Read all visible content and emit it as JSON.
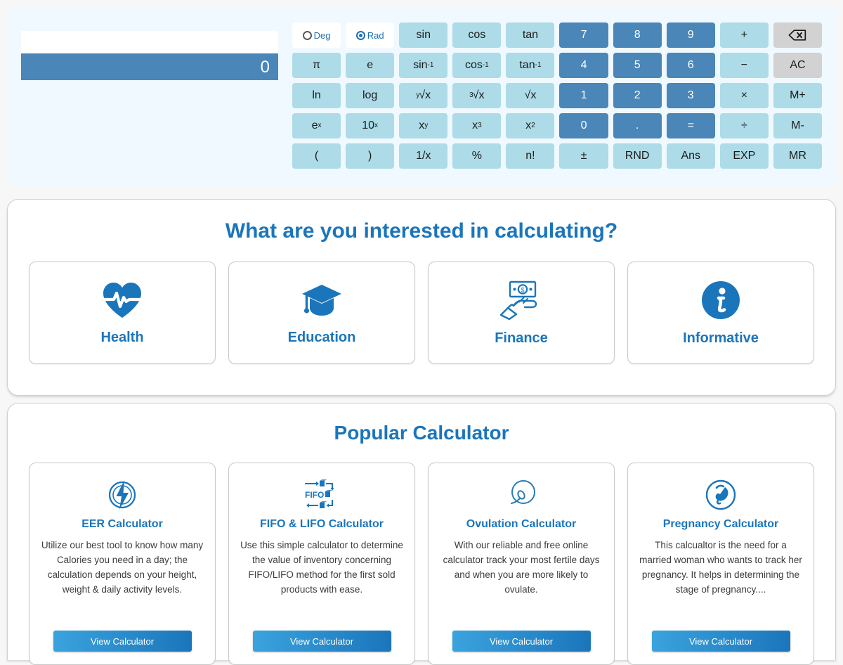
{
  "calculator": {
    "expression": "",
    "result": "0",
    "angle_modes": [
      {
        "label": "Deg",
        "selected": false
      },
      {
        "label": "Rad",
        "selected": true
      }
    ],
    "keys": [
      {
        "label": "sin",
        "type": "func"
      },
      {
        "label": "cos",
        "type": "func"
      },
      {
        "label": "tan",
        "type": "func"
      },
      {
        "label": "7",
        "type": "num"
      },
      {
        "label": "8",
        "type": "num"
      },
      {
        "label": "9",
        "type": "num"
      },
      {
        "label": "+",
        "type": "func"
      },
      {
        "label": "backspace-icon",
        "type": "gray"
      },
      {
        "label": "π",
        "type": "func"
      },
      {
        "label": "e",
        "type": "func"
      },
      {
        "label": "sin-1",
        "type": "func"
      },
      {
        "label": "cos-1",
        "type": "func"
      },
      {
        "label": "tan-1",
        "type": "func"
      },
      {
        "label": "4",
        "type": "num"
      },
      {
        "label": "5",
        "type": "num"
      },
      {
        "label": "6",
        "type": "num"
      },
      {
        "label": "−",
        "type": "func"
      },
      {
        "label": "AC",
        "type": "gray"
      },
      {
        "label": "ln",
        "type": "func"
      },
      {
        "label": "log",
        "type": "func"
      },
      {
        "label": "y√x",
        "type": "func"
      },
      {
        "label": "3√x",
        "type": "func"
      },
      {
        "label": "√x",
        "type": "func"
      },
      {
        "label": "1",
        "type": "num"
      },
      {
        "label": "2",
        "type": "num"
      },
      {
        "label": "3",
        "type": "num"
      },
      {
        "label": "×",
        "type": "func"
      },
      {
        "label": "M+",
        "type": "func"
      },
      {
        "label": "ex",
        "type": "func"
      },
      {
        "label": "10x",
        "type": "func"
      },
      {
        "label": "xy",
        "type": "func"
      },
      {
        "label": "x3",
        "type": "func"
      },
      {
        "label": "x2",
        "type": "func"
      },
      {
        "label": "0",
        "type": "num"
      },
      {
        "label": ".",
        "type": "num"
      },
      {
        "label": "=",
        "type": "num"
      },
      {
        "label": "÷",
        "type": "func"
      },
      {
        "label": "M-",
        "type": "func"
      },
      {
        "label": "(",
        "type": "func"
      },
      {
        "label": ")",
        "type": "func"
      },
      {
        "label": "1/x",
        "type": "func"
      },
      {
        "label": "%",
        "type": "func"
      },
      {
        "label": "n!",
        "type": "func"
      },
      {
        "label": "±",
        "type": "func"
      },
      {
        "label": "RND",
        "type": "func"
      },
      {
        "label": "Ans",
        "type": "func"
      },
      {
        "label": "EXP",
        "type": "func"
      },
      {
        "label": "MR",
        "type": "func"
      }
    ]
  },
  "categories": {
    "title": "What are you interested in calculating?",
    "items": [
      {
        "label": "Health",
        "icon": "heart-pulse-icon"
      },
      {
        "label": "Education",
        "icon": "graduation-cap-icon"
      },
      {
        "label": "Finance",
        "icon": "hand-money-icon"
      },
      {
        "label": "Informative",
        "icon": "info-circle-icon"
      }
    ]
  },
  "popular": {
    "title": "Popular Calculator",
    "button_label": "View Calculator",
    "items": [
      {
        "icon": "lightning-bolt-circle-icon",
        "title": "EER Calculator",
        "description": "Utilize our best tool to know how many Calories you need in a day; the calculation depends on your height, weight & daily activity levels."
      },
      {
        "icon": "fifo-boxes-icon",
        "title": "FIFO & LIFO Calculator",
        "description": "Use this simple calculator to determine the value of inventory concerning FIFO/LIFO method for the first sold products with ease."
      },
      {
        "icon": "ovum-icon",
        "title": "Ovulation Calculator",
        "description": "With our reliable and free online calculator track your most fertile days and when you are more likely to ovulate."
      },
      {
        "icon": "fetus-circle-icon",
        "title": "Pregnancy Calculator",
        "description": "This calcualtor is the need for a married woman who wants to track her pregnancy. It helps in determining the stage of pregnancy...."
      }
    ]
  },
  "colors": {
    "brand_blue": "#1b75bb",
    "key_dark_blue": "#4a86b8",
    "key_light_blue": "#addbe8",
    "key_gray": "#d2d2d2",
    "panel_tint": "#f0f9ff"
  }
}
